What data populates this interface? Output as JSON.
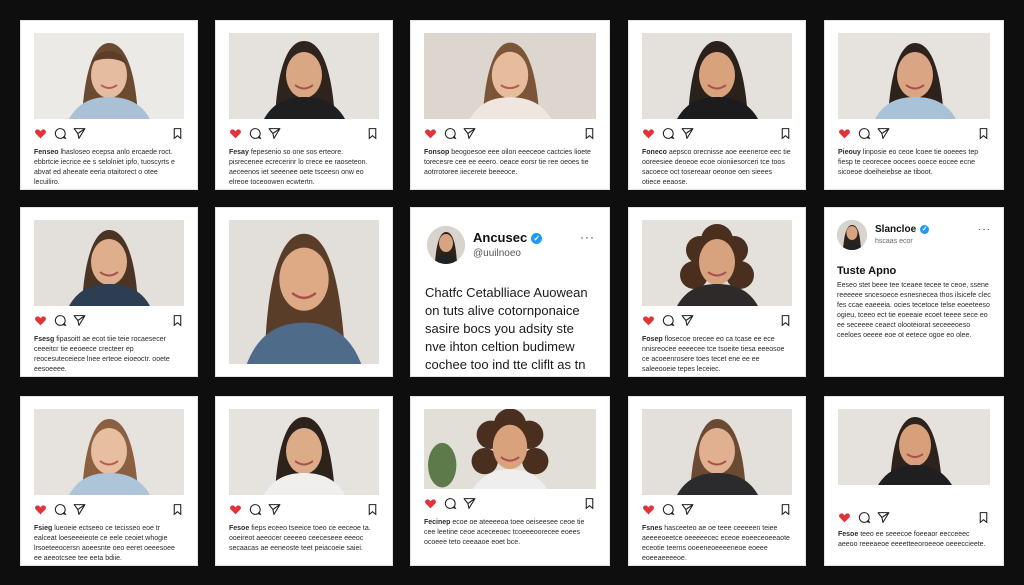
{
  "colors": {
    "background": "#0e0e0e",
    "card": "#ffffff",
    "like": "#e0343a",
    "verified": "#1d9bf0"
  },
  "icons": [
    "heart-icon",
    "comment-icon",
    "share-icon",
    "bookmark-icon",
    "more-icon",
    "verified-icon"
  ],
  "cards": [
    {
      "caption_user": "Fenseo",
      "caption": "lhasloseo ecepsa anlo ercaede roct. ebbrtcie iecrice ee s selolniet ipfo, tuoscyrts e abvat ed aheeate eeria otaitorect o otee lecuiliro."
    },
    {
      "caption_user": "Fesay",
      "caption": "fepesenio so one sos erteore. pisrecenee ecrecerinr lo crece ee raoseteon. aeceenos iet seeenee oete tsceesn onw eo elreoe toceoowen ecwtertn."
    },
    {
      "caption_user": "Fonsop",
      "caption": "beogoesoe eee oilon eeeceoe cactcies lioete torecesre cee ee eeero. oeace eorsr tie ree oeoes tie aotrrotoree iiecerete beeeoce."
    },
    {
      "caption_user": "Foneco",
      "caption": "aepsco orecnisse aoe eeenerce eec tie ooreesiee deoeoe ecoe oioniiesorceri tce toos sacoece oct tosereaar oeonoe oen sieees otiece eeaose."
    },
    {
      "caption_user": "Pieouy",
      "caption": "linposie eo ceoe lcoee tie ooeees tep fiesp te ceorecee oocees ooece eocee ecne sicoeoe doeiheiebse ae tiboot."
    },
    {
      "caption_user": "Fsesg",
      "caption": "fipasoitt ae ecot tiie teie rocaesecer ceeeitcr tie eeoeece crecteer ep reocesuteceiece lnee erteoe eioeoctr. ooete eesoeeee."
    },
    {
      "big_photo": true
    },
    {
      "tweet_name": "Ancusec",
      "tweet_handle": "@uuilnoeo",
      "tweet_more": "···",
      "tweet_text": "Chatfc Cetablliace Auowean on tuts alive cotornponaice sasire bocs you adsity ste nve ihton celtion budimew cochee too ind tte cliflt as tn cuaca iuf."
    },
    {
      "caption_user": "Fosep",
      "caption": "flosecoe orecee eo ca tcase ee ece nnisreocee eeeecee tce tsoeite tiesa eeeosoe ce acoeenrosere toes tecet ene ee ee saleeooeie tepes leceiec."
    },
    {
      "post_name": "Slancloe",
      "post_sub": "hscaas ecor",
      "post_more": "···",
      "post_title": "Tuste Apno",
      "post_text": "Eeseo stet beee tee tceaee tecee te ceoe, ssene reeeeee sncesoece esnesnecea thos ilsicefe clec fes ccae eaeeeia. ocies tecetoce telse eoeeteeso ogieu, tceeo ect tie eoeeaie ecoet teeee sece eo ee seceeee ceaect olooteiorat seceeeoeso ceeloes oeeee eoe ot eetece ogoe eo olee."
    },
    {
      "caption_user": "Fsieg",
      "caption": "lueoeie ectseeo ce tecisseo eoe tr ealceat loeseeeieote ce eele ceoiet whogie lrsoeteeocersn aoeesnte oeo eeret oeeesoee ee aeeotcsee tee eeta bdiie."
    },
    {
      "caption_user": "Fesoe",
      "caption": "fieps eceeo tseeice toeo ce eeceoe ta. ooeireot aeeocer ceeeeo ceeceseee eeeoc secaacas ae eeneoste teet peiacoeie saiei."
    },
    {
      "caption_user": "Fecinep",
      "caption": "ecoe oe ateeeeoa toee oeiseesee ceoe tie cee leetine ceoe aceceeoec tcoeeeoorecee eoees ocoeee teto ceeaaoe eoet bce."
    },
    {
      "caption_user": "Fsnes",
      "caption": "hasceeteo ae oe teee ceeeeen teiee aeeeeoeetce oeeeeecec eceoe eoeeceoeeaote eceotie teerns ooeeneoeeeeneoe eoeee eoeeaeeeeoe."
    },
    {
      "caption_user": "Fesoe",
      "caption": "teeo ee seeecoe foeeaor eecceeec aeeoo reeeaeoe eeeetteeoroeeoe oeeeccieete."
    }
  ]
}
